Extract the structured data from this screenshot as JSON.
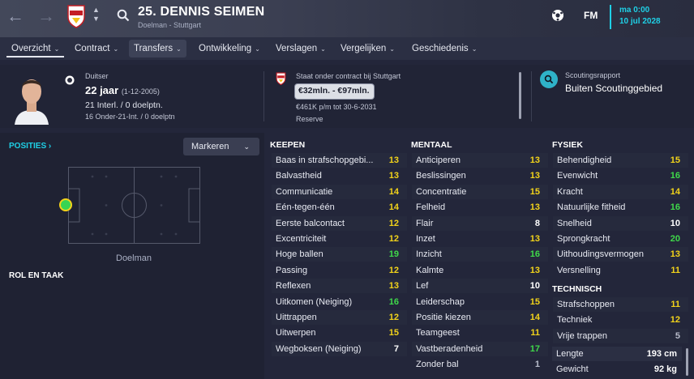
{
  "header": {
    "title": "25. DENNIS SEIMEN",
    "subtitle": "Doelman - Stuttgart",
    "time": "ma 0:00",
    "date": "10 jul 2028",
    "fm_label": "FM"
  },
  "tabs": [
    {
      "label": "Overzicht"
    },
    {
      "label": "Contract"
    },
    {
      "label": "Transfers"
    },
    {
      "label": "Ontwikkeling"
    },
    {
      "label": "Verslagen"
    },
    {
      "label": "Vergelijken"
    },
    {
      "label": "Geschiedenis"
    }
  ],
  "player": {
    "nationality": "Duitser",
    "age": "22 jaar",
    "dob": "(1-12-2005)",
    "caps": "21 Interl. / 0 doelptn.",
    "u21": "16 Onder-21-Int. / 0 doelptn"
  },
  "contract": {
    "status": "Staat onder contract bij Stuttgart",
    "value": "€32mln. - €97mln.",
    "wage": "€461K p/m tot 30-6-2031",
    "role": "Reserve"
  },
  "scouting": {
    "title": "Scoutingsrapport",
    "value": "Buiten Scoutinggebied"
  },
  "left": {
    "positions_label": "POSITIES",
    "mark_button": "Markeren",
    "position_name": "Doelman",
    "role_label": "ROL EN TAAK"
  },
  "colors": {
    "accent": "#1fd0e6",
    "yellow": "#f2d31a",
    "green": "#3fd94a"
  },
  "keepen": {
    "header": "KEEPEN",
    "rows": [
      {
        "name": "Baas in strafschopgebi...",
        "value": "13",
        "color": "yellow"
      },
      {
        "name": "Balvastheid",
        "value": "13",
        "color": "yellow"
      },
      {
        "name": "Communicatie",
        "value": "14",
        "color": "yellow"
      },
      {
        "name": "Eén-tegen-één",
        "value": "14",
        "color": "yellow"
      },
      {
        "name": "Eerste balcontact",
        "value": "12",
        "color": "yellow"
      },
      {
        "name": "Excentriciteit",
        "value": "12",
        "color": "yellow"
      },
      {
        "name": "Hoge ballen",
        "value": "19",
        "color": "green"
      },
      {
        "name": "Passing",
        "value": "12",
        "color": "yellow"
      },
      {
        "name": "Reflexen",
        "value": "13",
        "color": "yellow"
      },
      {
        "name": "Uitkomen (Neiging)",
        "value": "16",
        "color": "green"
      },
      {
        "name": "Uittrappen",
        "value": "12",
        "color": "yellow"
      },
      {
        "name": "Uitwerpen",
        "value": "15",
        "color": "yellow"
      },
      {
        "name": "Wegboksen (Neiging)",
        "value": "7",
        "color": "white"
      }
    ]
  },
  "mentaal": {
    "header": "MENTAAL",
    "rows": [
      {
        "name": "Anticiperen",
        "value": "13",
        "color": "yellow"
      },
      {
        "name": "Beslissingen",
        "value": "13",
        "color": "yellow"
      },
      {
        "name": "Concentratie",
        "value": "15",
        "color": "yellow"
      },
      {
        "name": "Felheid",
        "value": "13",
        "color": "yellow"
      },
      {
        "name": "Flair",
        "value": "8",
        "color": "white"
      },
      {
        "name": "Inzet",
        "value": "13",
        "color": "yellow"
      },
      {
        "name": "Inzicht",
        "value": "16",
        "color": "green"
      },
      {
        "name": "Kalmte",
        "value": "13",
        "color": "yellow"
      },
      {
        "name": "Lef",
        "value": "10",
        "color": "white"
      },
      {
        "name": "Leiderschap",
        "value": "15",
        "color": "yellow"
      },
      {
        "name": "Positie kiezen",
        "value": "14",
        "color": "yellow"
      },
      {
        "name": "Teamgeest",
        "value": "11",
        "color": "yellow"
      },
      {
        "name": "Vastberadenheid",
        "value": "17",
        "color": "green"
      },
      {
        "name": "Zonder bal",
        "value": "1",
        "color": "grey"
      }
    ]
  },
  "fysiek": {
    "header": "FYSIEK",
    "rows": [
      {
        "name": "Behendigheid",
        "value": "15",
        "color": "yellow"
      },
      {
        "name": "Evenwicht",
        "value": "16",
        "color": "green"
      },
      {
        "name": "Kracht",
        "value": "14",
        "color": "yellow"
      },
      {
        "name": "Natuurlijke fitheid",
        "value": "16",
        "color": "green"
      },
      {
        "name": "Snelheid",
        "value": "10",
        "color": "white"
      },
      {
        "name": "Sprongkracht",
        "value": "20",
        "color": "green"
      },
      {
        "name": "Uithoudingsvermogen",
        "value": "13",
        "color": "yellow"
      },
      {
        "name": "Versnelling",
        "value": "11",
        "color": "yellow"
      }
    ]
  },
  "technisch": {
    "header": "TECHNISCH",
    "rows": [
      {
        "name": "Strafschoppen",
        "value": "11",
        "color": "yellow"
      },
      {
        "name": "Techniek",
        "value": "12",
        "color": "yellow"
      },
      {
        "name": "Vrije trappen",
        "value": "5",
        "color": "grey"
      }
    ]
  },
  "stats": {
    "height_label": "Lengte",
    "height": "193 cm",
    "weight_label": "Gewicht",
    "weight": "92 kg"
  }
}
